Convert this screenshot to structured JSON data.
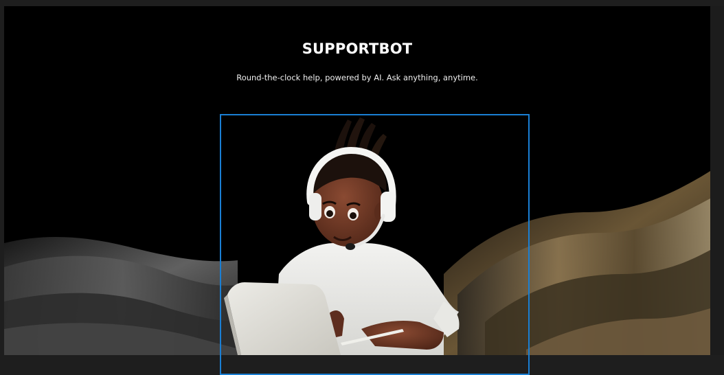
{
  "hero": {
    "title": "SUPPORTBOT",
    "subtitle": "Round-the-clock help, powered by AI. Ask anything, anytime."
  },
  "illustration": {
    "subject": "support-agent-with-headset",
    "icon": "headset-icon"
  },
  "colors": {
    "background": "#000000",
    "page": "#1e1e1e",
    "selection_outline": "#1a7fd4",
    "title_text": "#ffffff"
  }
}
